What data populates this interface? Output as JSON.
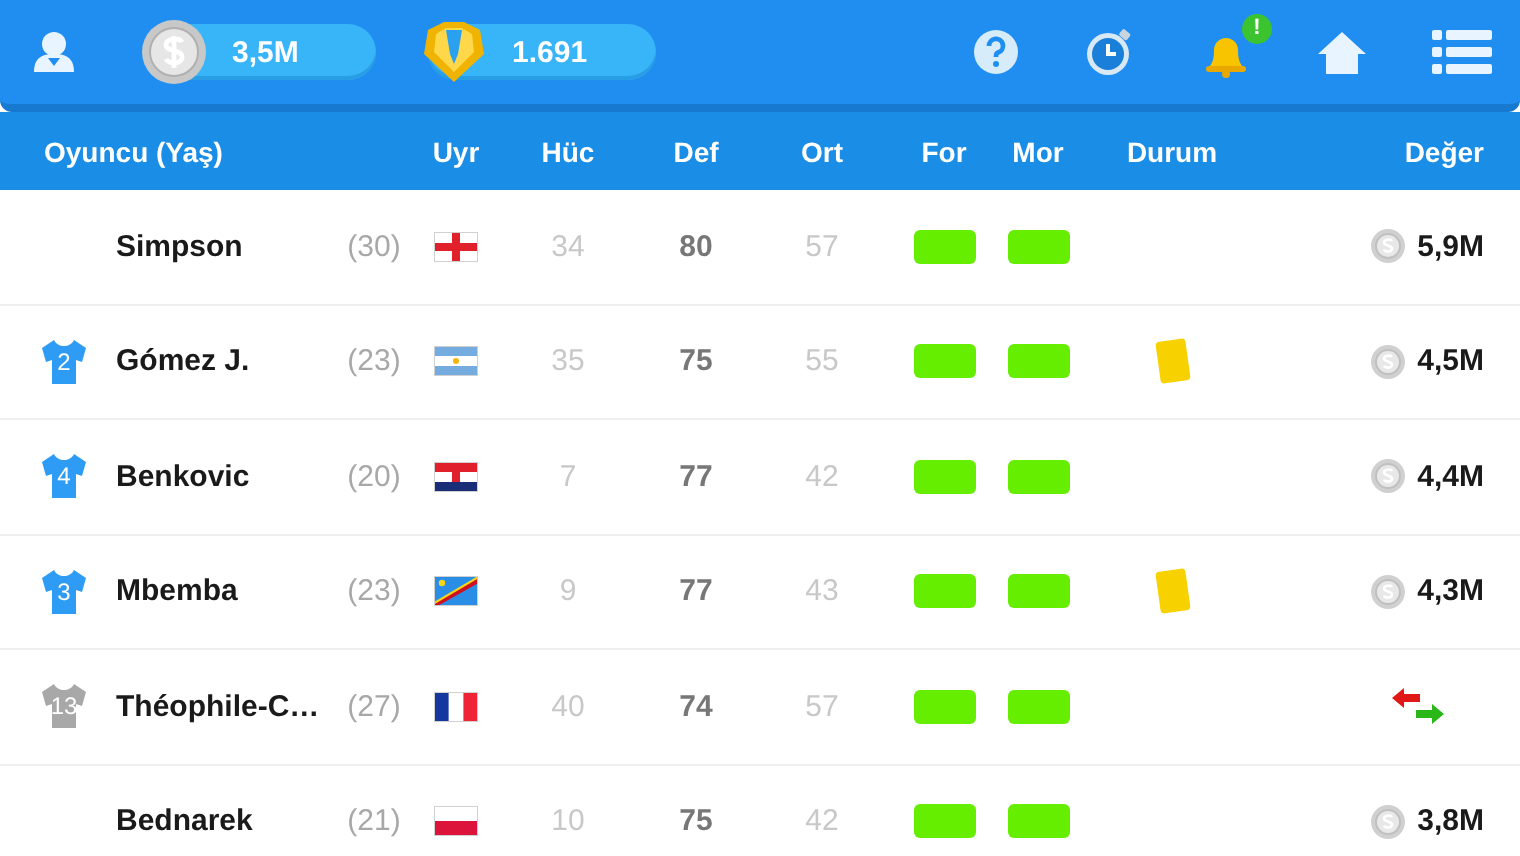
{
  "top_bar": {
    "money": "3,5M",
    "tokens": "1.691",
    "notification": "!"
  },
  "columns": [
    "Oyuncu (Yaş)",
    "Uyr",
    "Hüc",
    "Def",
    "Ort",
    "For",
    "Mor",
    "Durum",
    "Değer"
  ],
  "players": [
    {
      "shirt": {
        "kind": "none"
      },
      "name": "Simpson",
      "age": "(30)",
      "flag": {
        "kind": "england"
      },
      "att": "34",
      "def": "80",
      "mid": "57",
      "form": {
        "color": "#66ee00"
      },
      "morale": {
        "color": "#66ee00"
      },
      "status": {
        "kind": "none"
      },
      "value": "5,9M"
    },
    {
      "shirt": {
        "kind": "starter",
        "number": "2"
      },
      "name": "Gómez J.",
      "age": "(23)",
      "flag": {
        "kind": "argentina"
      },
      "att": "35",
      "def": "75",
      "mid": "55",
      "form": {
        "color": "#66ee00"
      },
      "morale": {
        "color": "#66ee00"
      },
      "status": {
        "kind": "yellow-card"
      },
      "value": "4,5M"
    },
    {
      "shirt": {
        "kind": "starter",
        "number": "4"
      },
      "name": "Benkovic",
      "age": "(20)",
      "flag": {
        "kind": "croatia"
      },
      "att": "7",
      "def": "77",
      "mid": "42",
      "form": {
        "color": "#66ee00"
      },
      "morale": {
        "color": "#66ee00"
      },
      "status": {
        "kind": "none"
      },
      "value": "4,4M"
    },
    {
      "shirt": {
        "kind": "starter",
        "number": "3"
      },
      "name": "Mbemba",
      "age": "(23)",
      "flag": {
        "kind": "dr-congo"
      },
      "att": "9",
      "def": "77",
      "mid": "43",
      "form": {
        "color": "#66ee00"
      },
      "morale": {
        "color": "#66ee00"
      },
      "status": {
        "kind": "yellow-card"
      },
      "value": "4,3M"
    },
    {
      "shirt": {
        "kind": "substitute",
        "number": "13"
      },
      "name": "Théophile-C…",
      "age": "(27)",
      "flag": {
        "kind": "france"
      },
      "att": "40",
      "def": "74",
      "mid": "57",
      "form": {
        "color": "#66ee00"
      },
      "morale": {
        "color": "#66ee00"
      },
      "status": {
        "kind": "none"
      },
      "transfer": true
    },
    {
      "shirt": {
        "kind": "none"
      },
      "name": "Bednarek",
      "age": "(21)",
      "flag": {
        "kind": "poland"
      },
      "att": "10",
      "def": "75",
      "mid": "42",
      "form": {
        "color": "#66ee00"
      },
      "morale": {
        "color": "#66ee00"
      },
      "status": {
        "kind": "none"
      },
      "value": "3,8M"
    }
  ]
}
